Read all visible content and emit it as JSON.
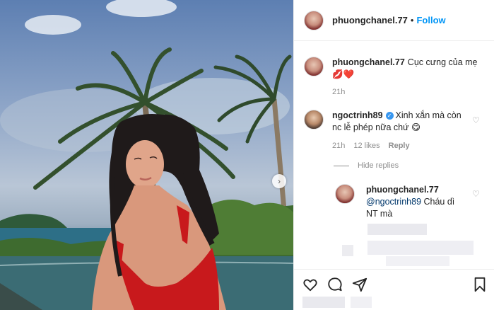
{
  "post": {
    "username": "phuongchanel.77",
    "follow_label": "Follow",
    "separator": "•"
  },
  "comments": [
    {
      "username": "phuongchanel.77",
      "text": "Cục cưng của mẹ",
      "emoji": "💋❤️",
      "time": "21h"
    },
    {
      "username": "ngoctrinh89",
      "text": "Xinh xắn mà còn nc lễ phép nữa chứ 😋",
      "time": "21h",
      "likes": "12 likes",
      "reply_label": "Reply",
      "hide_replies_label": "Hide replies"
    }
  ],
  "reply": {
    "username": "phuongchanel.77",
    "mention": "@ngoctrinh89",
    "text": "Cháu dì NT mà"
  },
  "icons": {
    "like": "heart-icon",
    "comment": "comment-icon",
    "share": "share-icon",
    "save": "bookmark-icon",
    "next": "chevron-right-icon"
  }
}
